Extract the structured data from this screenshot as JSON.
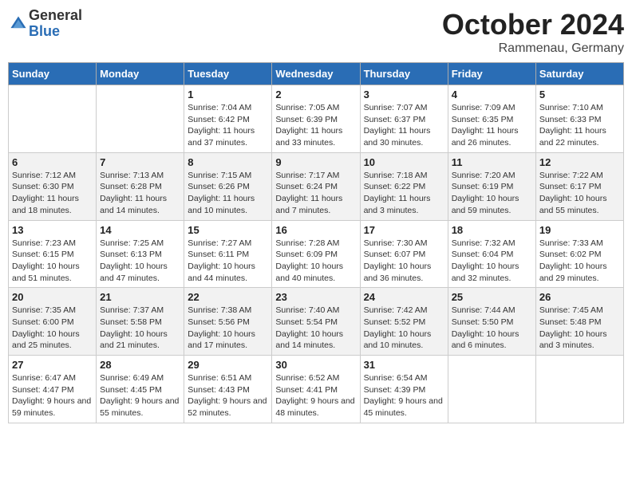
{
  "header": {
    "logo_general": "General",
    "logo_blue": "Blue",
    "month": "October 2024",
    "location": "Rammenau, Germany"
  },
  "days_of_week": [
    "Sunday",
    "Monday",
    "Tuesday",
    "Wednesday",
    "Thursday",
    "Friday",
    "Saturday"
  ],
  "weeks": [
    [
      {
        "day": "",
        "info": ""
      },
      {
        "day": "",
        "info": ""
      },
      {
        "day": "1",
        "info": "Sunrise: 7:04 AM\nSunset: 6:42 PM\nDaylight: 11 hours and 37 minutes."
      },
      {
        "day": "2",
        "info": "Sunrise: 7:05 AM\nSunset: 6:39 PM\nDaylight: 11 hours and 33 minutes."
      },
      {
        "day": "3",
        "info": "Sunrise: 7:07 AM\nSunset: 6:37 PM\nDaylight: 11 hours and 30 minutes."
      },
      {
        "day": "4",
        "info": "Sunrise: 7:09 AM\nSunset: 6:35 PM\nDaylight: 11 hours and 26 minutes."
      },
      {
        "day": "5",
        "info": "Sunrise: 7:10 AM\nSunset: 6:33 PM\nDaylight: 11 hours and 22 minutes."
      }
    ],
    [
      {
        "day": "6",
        "info": "Sunrise: 7:12 AM\nSunset: 6:30 PM\nDaylight: 11 hours and 18 minutes."
      },
      {
        "day": "7",
        "info": "Sunrise: 7:13 AM\nSunset: 6:28 PM\nDaylight: 11 hours and 14 minutes."
      },
      {
        "day": "8",
        "info": "Sunrise: 7:15 AM\nSunset: 6:26 PM\nDaylight: 11 hours and 10 minutes."
      },
      {
        "day": "9",
        "info": "Sunrise: 7:17 AM\nSunset: 6:24 PM\nDaylight: 11 hours and 7 minutes."
      },
      {
        "day": "10",
        "info": "Sunrise: 7:18 AM\nSunset: 6:22 PM\nDaylight: 11 hours and 3 minutes."
      },
      {
        "day": "11",
        "info": "Sunrise: 7:20 AM\nSunset: 6:19 PM\nDaylight: 10 hours and 59 minutes."
      },
      {
        "day": "12",
        "info": "Sunrise: 7:22 AM\nSunset: 6:17 PM\nDaylight: 10 hours and 55 minutes."
      }
    ],
    [
      {
        "day": "13",
        "info": "Sunrise: 7:23 AM\nSunset: 6:15 PM\nDaylight: 10 hours and 51 minutes."
      },
      {
        "day": "14",
        "info": "Sunrise: 7:25 AM\nSunset: 6:13 PM\nDaylight: 10 hours and 47 minutes."
      },
      {
        "day": "15",
        "info": "Sunrise: 7:27 AM\nSunset: 6:11 PM\nDaylight: 10 hours and 44 minutes."
      },
      {
        "day": "16",
        "info": "Sunrise: 7:28 AM\nSunset: 6:09 PM\nDaylight: 10 hours and 40 minutes."
      },
      {
        "day": "17",
        "info": "Sunrise: 7:30 AM\nSunset: 6:07 PM\nDaylight: 10 hours and 36 minutes."
      },
      {
        "day": "18",
        "info": "Sunrise: 7:32 AM\nSunset: 6:04 PM\nDaylight: 10 hours and 32 minutes."
      },
      {
        "day": "19",
        "info": "Sunrise: 7:33 AM\nSunset: 6:02 PM\nDaylight: 10 hours and 29 minutes."
      }
    ],
    [
      {
        "day": "20",
        "info": "Sunrise: 7:35 AM\nSunset: 6:00 PM\nDaylight: 10 hours and 25 minutes."
      },
      {
        "day": "21",
        "info": "Sunrise: 7:37 AM\nSunset: 5:58 PM\nDaylight: 10 hours and 21 minutes."
      },
      {
        "day": "22",
        "info": "Sunrise: 7:38 AM\nSunset: 5:56 PM\nDaylight: 10 hours and 17 minutes."
      },
      {
        "day": "23",
        "info": "Sunrise: 7:40 AM\nSunset: 5:54 PM\nDaylight: 10 hours and 14 minutes."
      },
      {
        "day": "24",
        "info": "Sunrise: 7:42 AM\nSunset: 5:52 PM\nDaylight: 10 hours and 10 minutes."
      },
      {
        "day": "25",
        "info": "Sunrise: 7:44 AM\nSunset: 5:50 PM\nDaylight: 10 hours and 6 minutes."
      },
      {
        "day": "26",
        "info": "Sunrise: 7:45 AM\nSunset: 5:48 PM\nDaylight: 10 hours and 3 minutes."
      }
    ],
    [
      {
        "day": "27",
        "info": "Sunrise: 6:47 AM\nSunset: 4:47 PM\nDaylight: 9 hours and 59 minutes."
      },
      {
        "day": "28",
        "info": "Sunrise: 6:49 AM\nSunset: 4:45 PM\nDaylight: 9 hours and 55 minutes."
      },
      {
        "day": "29",
        "info": "Sunrise: 6:51 AM\nSunset: 4:43 PM\nDaylight: 9 hours and 52 minutes."
      },
      {
        "day": "30",
        "info": "Sunrise: 6:52 AM\nSunset: 4:41 PM\nDaylight: 9 hours and 48 minutes."
      },
      {
        "day": "31",
        "info": "Sunrise: 6:54 AM\nSunset: 4:39 PM\nDaylight: 9 hours and 45 minutes."
      },
      {
        "day": "",
        "info": ""
      },
      {
        "day": "",
        "info": ""
      }
    ]
  ]
}
